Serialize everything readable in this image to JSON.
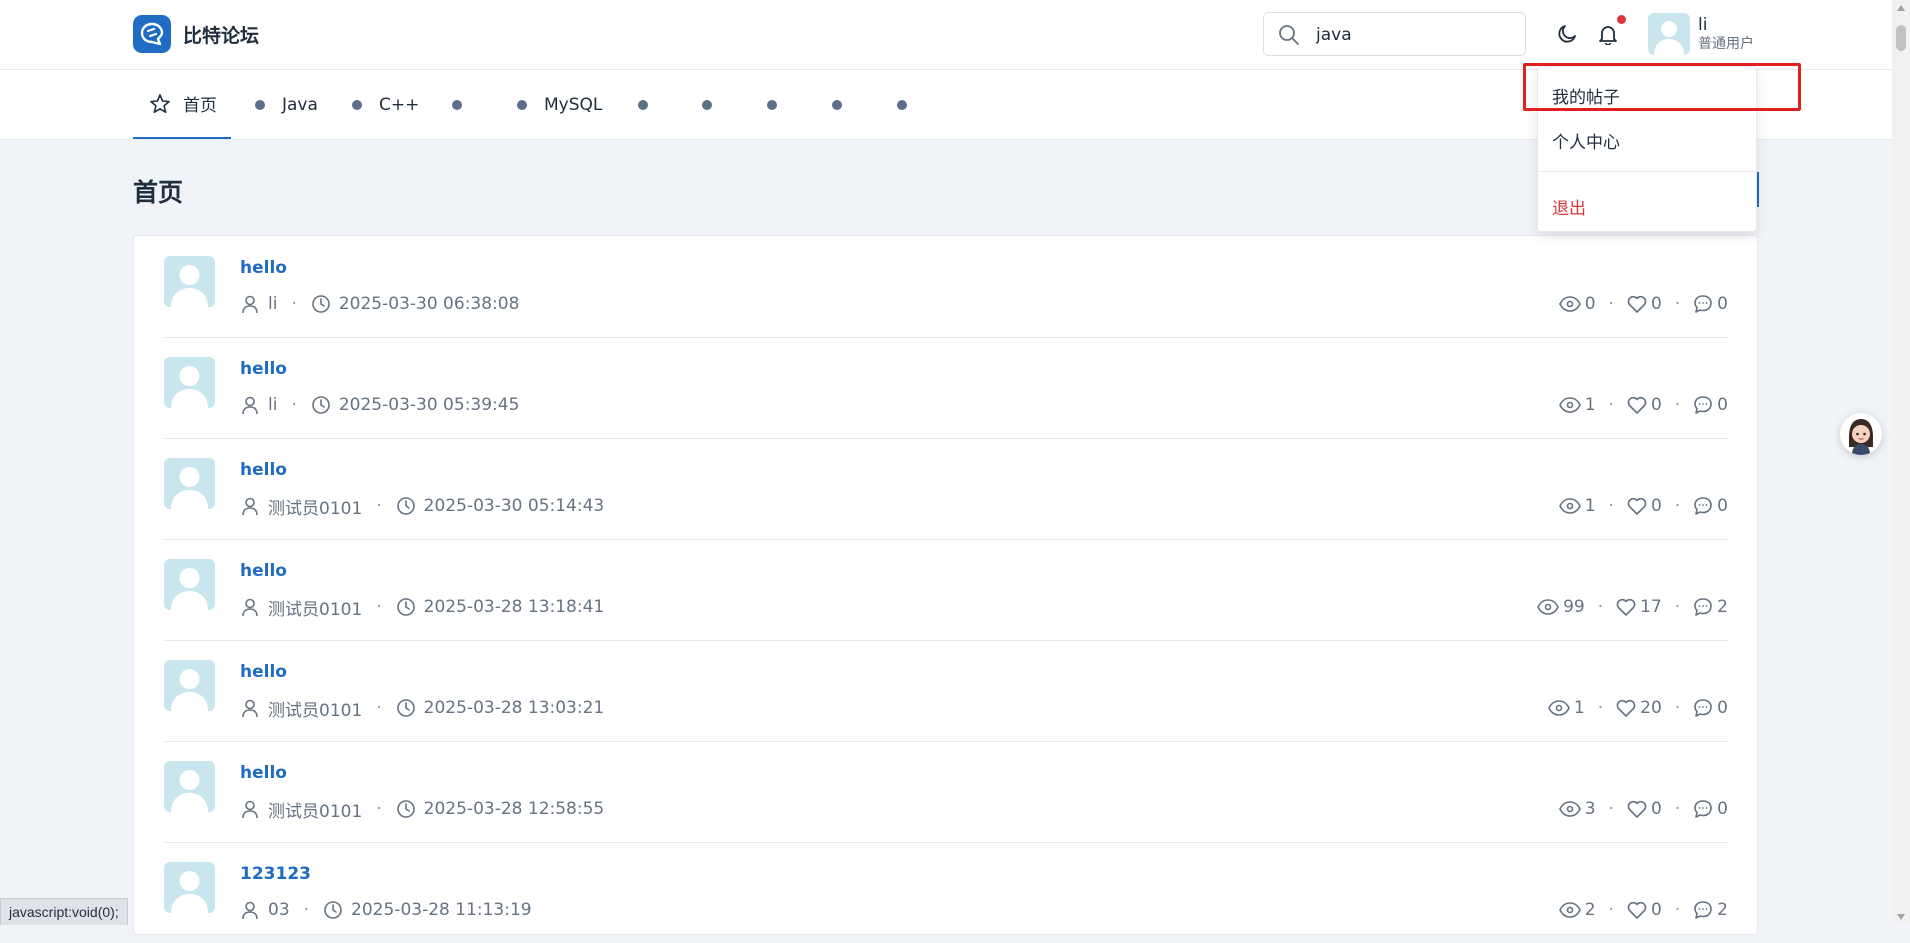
{
  "header": {
    "site_name": "比特论坛",
    "search_value": "java",
    "user_name": "li",
    "user_role": "普通用户",
    "has_notification": true
  },
  "nav": {
    "items": [
      {
        "label": "首页",
        "active": true
      },
      {
        "label": "Java"
      },
      {
        "label": "C++"
      },
      {
        "label": ""
      },
      {
        "label": "MySQL"
      },
      {
        "label": ""
      },
      {
        "label": ""
      },
      {
        "label": ""
      },
      {
        "label": ""
      },
      {
        "label": ""
      }
    ]
  },
  "page": {
    "title": "首页"
  },
  "dropdown": {
    "my_posts": "我的帖子",
    "profile": "个人中心",
    "logout": "退出"
  },
  "posts": [
    {
      "title": "hello",
      "author": "li",
      "time": "2025-03-30 06:38:08",
      "views": "0",
      "likes": "0",
      "comments": "0"
    },
    {
      "title": "hello",
      "author": "li",
      "time": "2025-03-30 05:39:45",
      "views": "1",
      "likes": "0",
      "comments": "0"
    },
    {
      "title": "hello",
      "author": "测试员0101",
      "time": "2025-03-30 05:14:43",
      "views": "1",
      "likes": "0",
      "comments": "0"
    },
    {
      "title": "hello",
      "author": "测试员0101",
      "time": "2025-03-28 13:18:41",
      "views": "99",
      "likes": "17",
      "comments": "2"
    },
    {
      "title": "hello",
      "author": "测试员0101",
      "time": "2025-03-28 13:03:21",
      "views": "1",
      "likes": "20",
      "comments": "0"
    },
    {
      "title": "hello",
      "author": "测试员0101",
      "time": "2025-03-28 12:58:55",
      "views": "3",
      "likes": "0",
      "comments": "0"
    },
    {
      "title": "123123",
      "author": "03",
      "time": "2025-03-28 11:13:19",
      "views": "2",
      "likes": "0",
      "comments": "2"
    }
  ],
  "status_bar": "javascript:void(0);",
  "colors": {
    "primary": "#206bc4",
    "danger": "#d63939",
    "background": "#f0f3f8",
    "highlight_box": "#e11f1f"
  },
  "icons": [
    "search-icon",
    "moon-icon",
    "bell-icon",
    "star-icon",
    "user-icon",
    "clock-icon",
    "eye-icon",
    "heart-icon",
    "comment-icon"
  ]
}
